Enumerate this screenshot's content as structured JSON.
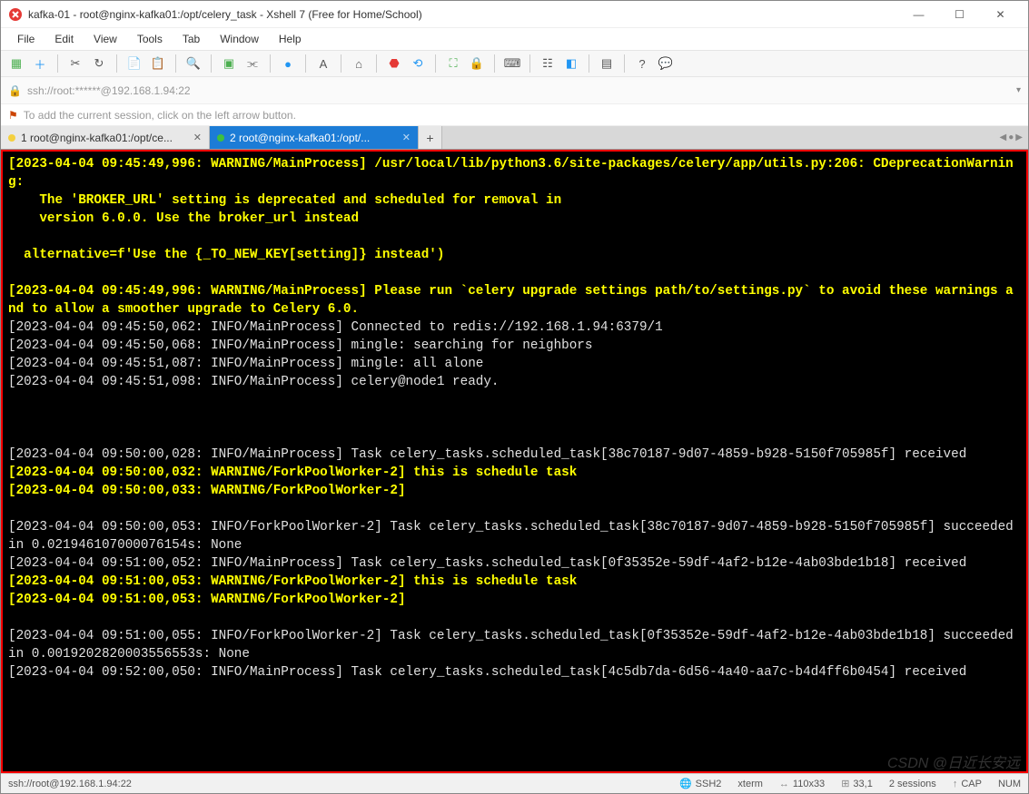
{
  "window": {
    "title": "kafka-01 - root@nginx-kafka01:/opt/celery_task - Xshell 7 (Free for Home/School)"
  },
  "win_ctrl": {
    "min": "—",
    "max": "☐",
    "close": "✕"
  },
  "menu": {
    "file": "File",
    "edit": "Edit",
    "view": "View",
    "tools": "Tools",
    "tab": "Tab",
    "window": "Window",
    "help": "Help"
  },
  "address": {
    "url": "ssh://root:******@192.168.1.94:22"
  },
  "hint": {
    "text": "To add the current session, click on the left arrow button."
  },
  "tabs": {
    "inactive": {
      "label": "1 root@nginx-kafka01:/opt/ce..."
    },
    "active": {
      "label": "2 root@nginx-kafka01:/opt/..."
    },
    "add": "+"
  },
  "term": {
    "l1": "[2023-04-04 09:45:49,996: WARNING/MainProcess] /usr/local/lib/python3.6/site-packages/celery/app/utils.py:206: CDeprecationWarning: ",
    "l2": "    The 'BROKER_URL' setting is deprecated and scheduled for removal in",
    "l3": "    version 6.0.0. Use the broker_url instead",
    "l4": "",
    "l5": "  alternative=f'Use the {_TO_NEW_KEY[setting]} instead')",
    "l6": "",
    "l7": "[2023-04-04 09:45:49,996: WARNING/MainProcess] Please run `celery upgrade settings path/to/settings.py` to avoid these warnings and to allow a smoother upgrade to Celery 6.0.",
    "l8": "[2023-04-04 09:45:50,062: INFO/MainProcess] Connected to redis://192.168.1.94:6379/1",
    "l9": "[2023-04-04 09:45:50,068: INFO/MainProcess] mingle: searching for neighbors",
    "l10": "[2023-04-04 09:45:51,087: INFO/MainProcess] mingle: all alone",
    "l11": "[2023-04-04 09:45:51,098: INFO/MainProcess] celery@node1 ready.",
    "l12": "",
    "l13": "",
    "l14": "",
    "l15": "[2023-04-04 09:50:00,028: INFO/MainProcess] Task celery_tasks.scheduled_task[38c70187-9d07-4859-b928-5150f705985f] received",
    "l16": "[2023-04-04 09:50:00,032: WARNING/ForkPoolWorker-2] this is schedule task",
    "l17": "[2023-04-04 09:50:00,033: WARNING/ForkPoolWorker-2] ",
    "l18": "",
    "l19": "[2023-04-04 09:50:00,053: INFO/ForkPoolWorker-2] Task celery_tasks.scheduled_task[38c70187-9d07-4859-b928-5150f705985f] succeeded in 0.021946107000076154s: None",
    "l20": "[2023-04-04 09:51:00,052: INFO/MainProcess] Task celery_tasks.scheduled_task[0f35352e-59df-4af2-b12e-4ab03bde1b18] received",
    "l21": "[2023-04-04 09:51:00,053: WARNING/ForkPoolWorker-2] this is schedule task",
    "l22": "[2023-04-04 09:51:00,053: WARNING/ForkPoolWorker-2] ",
    "l23": "",
    "l24": "[2023-04-04 09:51:00,055: INFO/ForkPoolWorker-2] Task celery_tasks.scheduled_task[0f35352e-59df-4af2-b12e-4ab03bde1b18] succeeded in 0.0019202820003556553s: None",
    "l25": "[2023-04-04 09:52:00,050: INFO/MainProcess] Task celery_tasks.scheduled_task[4c5db7da-6d56-4a40-aa7c-b4d4ff6b0454] received"
  },
  "status": {
    "left": "ssh://root@192.168.1.94:22",
    "proto": "SSH2",
    "term": "xterm",
    "size": "110x33",
    "pos": "33,1",
    "sessions": "2 sessions",
    "cap": "CAP",
    "num": "NUM"
  },
  "watermark": "CSDN @日近长安远"
}
